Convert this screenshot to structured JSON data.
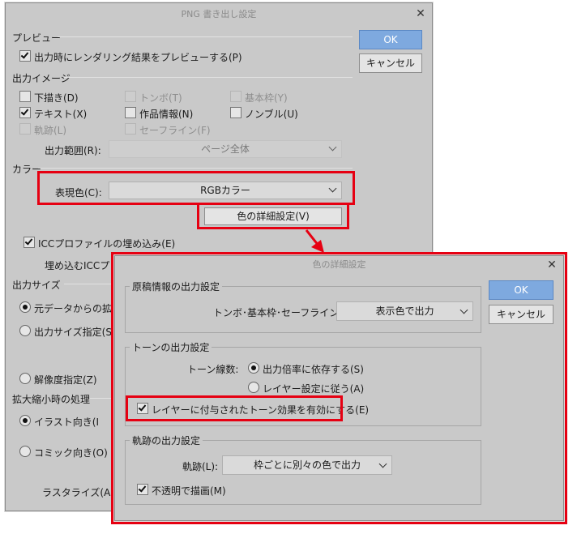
{
  "png_dialog": {
    "title": "PNG 書き出し設定",
    "ok_label": "OK",
    "cancel_label": "キャンセル",
    "preview_section": "プレビュー",
    "preview_checkbox": "出力時にレンダリング結果をプレビューする(P)",
    "output_image_section": "出力イメージ",
    "items": {
      "draft": "下描き(D)",
      "tombo": "トンボ(T)",
      "basic_frame": "基本枠(Y)",
      "text": "テキスト(X)",
      "work_info": "作品情報(N)",
      "nombre": "ノンブル(U)",
      "trail": "軌跡(L)",
      "safe_line": "セーフライン(F)"
    },
    "output_range_label": "出力範囲(R):",
    "output_range_value": "ページ全体",
    "color_section": "カラー",
    "color_mode_label": "表現色(C):",
    "color_mode_value": "RGBカラー",
    "color_detail_button": "色の詳細設定(V)",
    "icc_embed": "ICCプロファイルの埋め込み(E)",
    "icc_profile_label": "埋め込むICCプロフ",
    "output_size_section": "出力サイズ",
    "scale_from_original": "元データからの拡縮率",
    "output_size_specify": "出力サイズ指定(S)",
    "resolution_specify": "解像度指定(Z)",
    "scaling_section": "拡大縮小時の処理",
    "for_illust": "イラスト向き(I",
    "for_comic": "コミック向き(O)",
    "rasterize_label": "ラスタライズ(A):"
  },
  "color_dialog": {
    "title": "色の詳細設定",
    "ok_label": "OK",
    "cancel_label": "キャンセル",
    "source_group": "原稿情報の出力設定",
    "tombo_label": "トンボ･基本枠･セーフライン(T):",
    "tombo_value": "表示色で出力",
    "tone_group": "トーンの出力設定",
    "tone_lines_label": "トーン線数:",
    "tone_option_scale": "出力倍率に依存する(S)",
    "tone_option_layer": "レイヤー設定に従う(A)",
    "tone_effect_checkbox": "レイヤーに付与されたトーン効果を有効にする(E)",
    "trail_group": "軌跡の出力設定",
    "trail_label": "軌跡(L):",
    "trail_value": "枠ごとに別々の色で出力",
    "opaque_checkbox": "不透明で描画(M)"
  },
  "colors": {
    "highlight": "#e60012",
    "ok_button": "#7ea9df",
    "dialog_bg": "#c9c9c9"
  }
}
